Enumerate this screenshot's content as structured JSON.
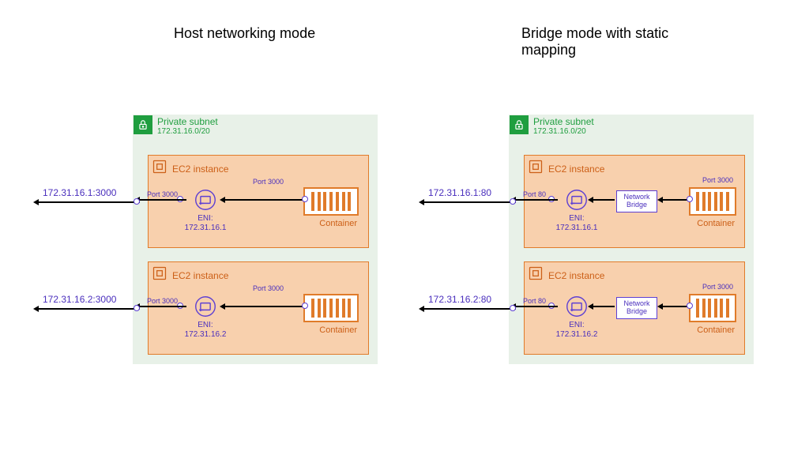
{
  "left": {
    "title": "Host networking mode",
    "subnet_name": "Private subnet",
    "subnet_cidr": "172.31.16.0/20",
    "instances": [
      {
        "label": "EC2 instance",
        "external": "172.31.16.1:3000",
        "host_port": "Port 3000",
        "container_port": "Port 3000",
        "container_label": "Container",
        "eni_name": "ENI:",
        "eni_ip": "172.31.16.1"
      },
      {
        "label": "EC2 instance",
        "external": "172.31.16.2:3000",
        "host_port": "Port 3000",
        "container_port": "Port 3000",
        "container_label": "Container",
        "eni_name": "ENI:",
        "eni_ip": "172.31.16.2"
      }
    ]
  },
  "right": {
    "title": "Bridge mode with static mapping",
    "subnet_name": "Private subnet",
    "subnet_cidr": "172.31.16.0/20",
    "instances": [
      {
        "label": "EC2 instance",
        "external": "172.31.16.1:80",
        "host_port": "Port 80",
        "bridge": "Network Bridge",
        "container_port": "Port 3000",
        "container_label": "Container",
        "eni_name": "ENI:",
        "eni_ip": "172.31.16.1"
      },
      {
        "label": "EC2 instance",
        "external": "172.31.16.2:80",
        "host_port": "Port 80",
        "bridge": "Network Bridge",
        "container_port": "Port 3000",
        "container_label": "Container",
        "eni_name": "ENI:",
        "eni_ip": "172.31.16.2"
      }
    ]
  }
}
